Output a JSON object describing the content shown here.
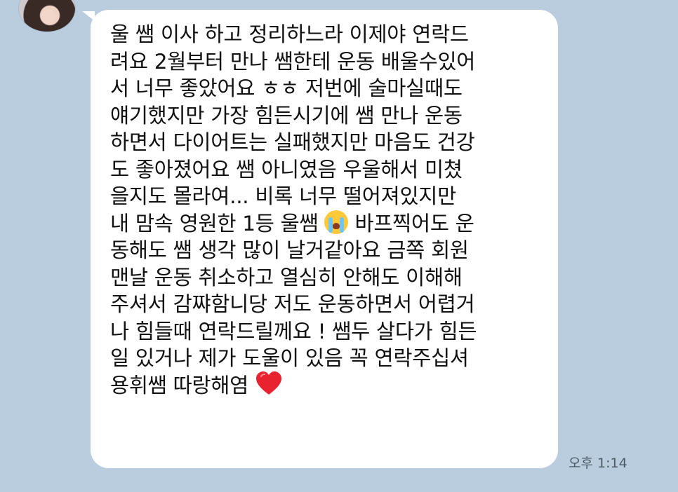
{
  "chat": {
    "message_lines": [
      "울 쌤 이사 하고 정리하느라 이제야 연락드",
      "려요 2월부터 만나 쌤한테 운동 배울수있어",
      "서 너무 좋았어요 ㅎㅎ 저번에 술마실때도",
      "얘기했지만 가장 힘든시기에 쌤 만나 운동",
      "하면서 다이어트는 실패했지만 마음도 건강",
      "도 좋아졌어요 쌤 아니였음 우울해서 미쳤",
      "을지도 몰라여... 비록 너무 떨어져있지만",
      "내 맘속 영원한 1등 울쌤",
      "바프찍어도 운",
      "동해도 쌤 생각 많이 날거같아요 금쪽 회원",
      "맨날 운동 취소하고 열심히 안해도 이해해",
      "주셔서 감쨔함니당 저도 운동하면서 어렵거",
      "나 힘들때 연락드릴께요 ! 쌤두 살다가 힘든",
      "일 있거나 제가 도울이 있음 꼭 연락주십셔",
      "용휘쌤 따랑해염"
    ],
    "time": "오후 1:14",
    "emoji_cry": "loudly-crying-face-emoji",
    "emoji_heart": "red-heart-emoji",
    "colors": {
      "background": "#b9cddf",
      "bubble": "#ffffff",
      "heart": "#e8232f"
    }
  }
}
